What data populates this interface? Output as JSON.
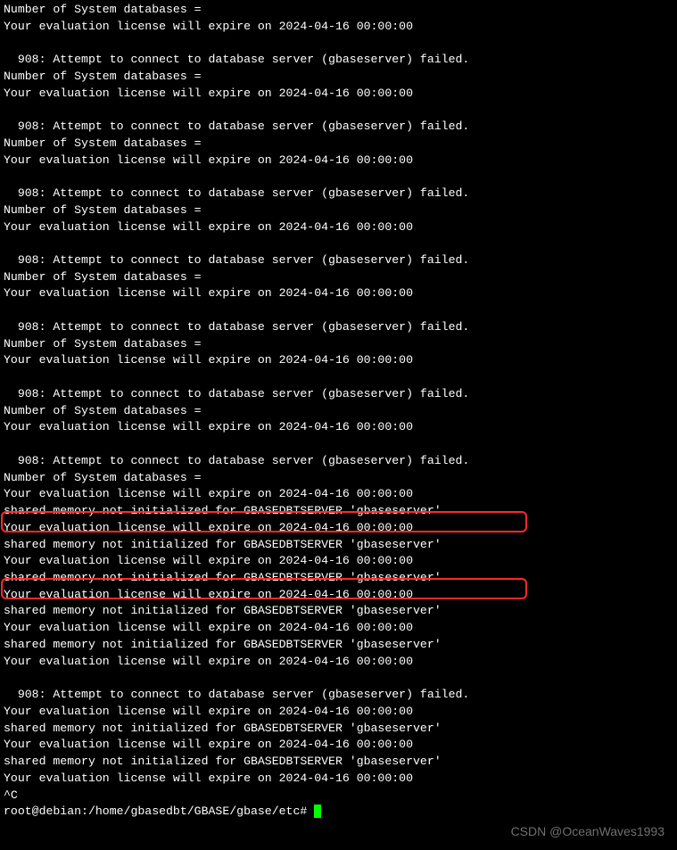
{
  "msg": {
    "sysdb": "Number of System databases =",
    "license": "Your evaluation license will expire on 2024-04-16 00:00:00",
    "connfail": "  908: Attempt to connect to database server (gbaseserver) failed.",
    "shmem": "shared memory not initialized for GBASEDBTSERVER 'gbaseserver'",
    "ctrlc": "^C"
  },
  "prompt": {
    "text": "root@debian:/home/gbasedbt/GBASE/gbase/etc# "
  },
  "watermark": "CSDN @OceanWaves1993"
}
